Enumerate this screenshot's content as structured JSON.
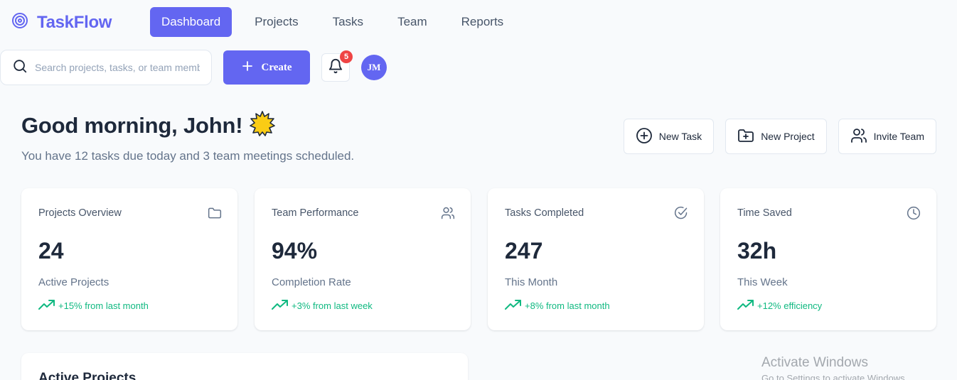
{
  "brand": {
    "name": "TaskFlow",
    "color": "#6366f1"
  },
  "nav": {
    "items": [
      {
        "label": "Dashboard",
        "active": true
      },
      {
        "label": "Projects",
        "active": false
      },
      {
        "label": "Tasks",
        "active": false
      },
      {
        "label": "Team",
        "active": false
      },
      {
        "label": "Reports",
        "active": false
      }
    ]
  },
  "toolbar": {
    "search_placeholder": "Search projects, tasks, or team members...",
    "search_value": "",
    "create_label": "Create",
    "notification_count": "5",
    "avatar_initials": "JM"
  },
  "greeting": {
    "title": "Good morning, John!",
    "emoji_icon": "sun-icon",
    "subtitle": "You have 12 tasks due today and 3 team meetings scheduled."
  },
  "quick_actions": [
    {
      "label": "New Task",
      "icon": "plus-circle-icon"
    },
    {
      "label": "New Project",
      "icon": "folder-plus-icon"
    },
    {
      "label": "Invite Team",
      "icon": "users-icon"
    }
  ],
  "stats": [
    {
      "title": "Projects Overview",
      "icon": "folder-icon",
      "value": "24",
      "label": "Active Projects",
      "trend": "+15% from last month"
    },
    {
      "title": "Team Performance",
      "icon": "users-icon",
      "value": "94%",
      "label": "Completion Rate",
      "trend": "+3% from last week"
    },
    {
      "title": "Tasks Completed",
      "icon": "check-circle-icon",
      "value": "247",
      "label": "This Month",
      "trend": "+8% from last month"
    },
    {
      "title": "Time Saved",
      "icon": "clock-icon",
      "value": "32h",
      "label": "This Week",
      "trend": "+12% efficiency"
    }
  ],
  "active_projects": {
    "title": "Active Projects"
  },
  "watermark": {
    "title": "Activate Windows",
    "subtitle": "Go to Settings to activate Windows."
  },
  "colors": {
    "accent": "#6366f1",
    "trend": "#10b981",
    "badge": "#ef4444"
  }
}
